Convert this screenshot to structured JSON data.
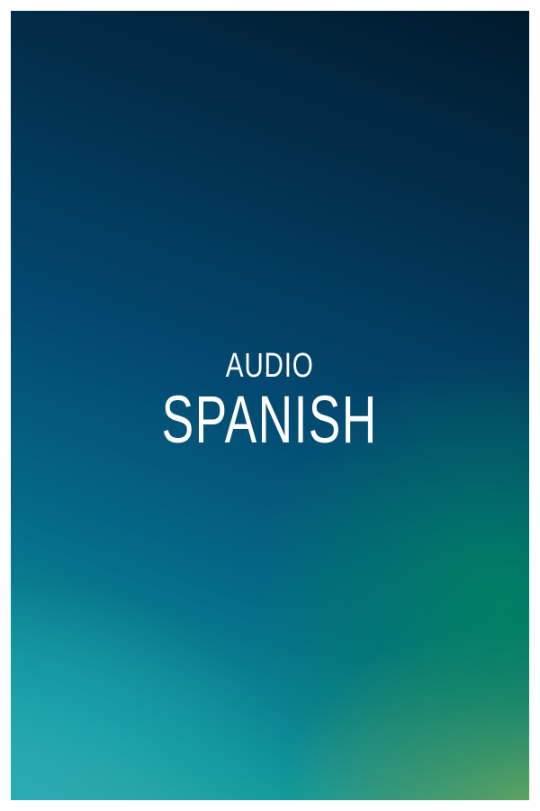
{
  "cover": {
    "subtitle": "AUDIO",
    "title": "SPANISH",
    "colors": {
      "top": "#001a2c",
      "middle": "#034a72",
      "bottom_left": "#28aab9",
      "bottom_right": "#78aa5f",
      "text": "#ffffff"
    }
  }
}
